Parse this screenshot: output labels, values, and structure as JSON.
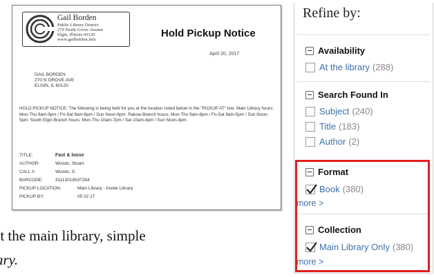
{
  "notice": {
    "logo": {
      "name": "Gail Borden",
      "lines": [
        "Public Library District",
        "270 North Grove Avenue",
        "Elgin, Illinois 60120",
        "www.gailborden.info"
      ]
    },
    "title": "Hold Pickup Notice",
    "date": "April 20, 2017",
    "address": [
      "GAIL BORDEN",
      "270 N GROVE AVE",
      "ELGIN, IL 60120"
    ],
    "body": "HOLD PICKUP NOTICE: The following is being held for you at the location noted below in the \"PICKUP AT\" line. Main Library hours: Mon-Thu 9am-9pm / Fri-Sat 9am-6pm / Sun Noon-6pm. Rakow Branch hours: Mon-Thu 9am-8pm / Fri-Sat 9am-5pm / Sun Noon-5pm. South Elgin Branch hours: Mon-Thu 10am-7pm / Sat 10am-4pm / Sun Noon-4pm",
    "fields": [
      {
        "key": "TITLE:",
        "value": "Fast & loose"
      },
      {
        "key": "AUTHOR:",
        "value": "Woods, Stuart."
      },
      {
        "key": "CALL #:",
        "value": "Woods, S."
      },
      {
        "key": "BARCODE:",
        "value": "31113018537264"
      },
      {
        "key": "PICKUP LOCATION:",
        "value": "Main Library - Inside Library"
      },
      {
        "key": "PICKUP BY:",
        "value": "05 02 17"
      }
    ]
  },
  "caption": {
    "line1": "at the main library, simple",
    "line2": "ary."
  },
  "refine": {
    "title": "Refine by:",
    "groups": {
      "availability": {
        "label": "Availability",
        "options": [
          {
            "label": "At the library",
            "count": "(288)"
          }
        ]
      },
      "search_found_in": {
        "label": "Search Found In",
        "options": [
          {
            "label": "Subject",
            "count": "(240)"
          },
          {
            "label": "Title",
            "count": "(183)"
          },
          {
            "label": "Author",
            "count": "(2)"
          }
        ]
      },
      "format": {
        "label": "Format",
        "options": [
          {
            "label": "Book",
            "count": "(380)"
          }
        ],
        "more": "more >"
      },
      "collection": {
        "label": "Collection",
        "options": [
          {
            "label": "Main Library Only",
            "count": "(380)"
          }
        ],
        "more": "more >"
      }
    }
  },
  "colors": {
    "link": "#3f6fa8",
    "highlight": "#e21c1c"
  }
}
